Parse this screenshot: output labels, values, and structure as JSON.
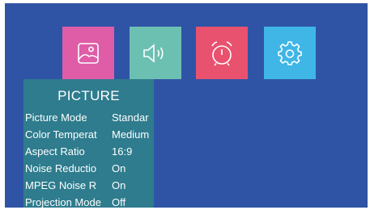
{
  "tiles": [
    {
      "id": "picture",
      "icon": "image-icon",
      "color": "#df5da7"
    },
    {
      "id": "sound",
      "icon": "speaker-icon",
      "color": "#6cc0b2"
    },
    {
      "id": "timer",
      "icon": "alarm-clock-icon",
      "color": "#e8526f"
    },
    {
      "id": "setup",
      "icon": "gear-icon",
      "color": "#3fb6e6"
    }
  ],
  "panel": {
    "title": "PICTURE",
    "rows": [
      {
        "label": "Picture Mode",
        "value": "Standar"
      },
      {
        "label": "Color Temperat",
        "value": "Medium"
      },
      {
        "label": "Aspect Ratio",
        "value": "16:9"
      },
      {
        "label": "Noise Reductio",
        "value": "On"
      },
      {
        "label": "MPEG Noise R",
        "value": "On"
      },
      {
        "label": "Projection Mode",
        "value": "Off"
      }
    ]
  },
  "colors": {
    "background": "#2f54a6",
    "panel": "#2e7c8d",
    "text": "#ffffff"
  }
}
